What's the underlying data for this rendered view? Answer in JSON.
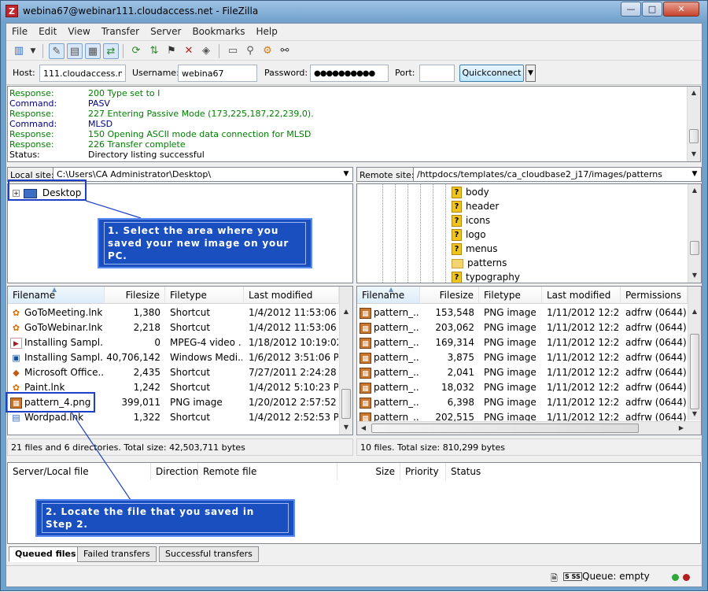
{
  "window": {
    "title": "webina67@webinar111.cloudaccess.net - FileZilla",
    "app_icon": "Z",
    "controls": {
      "minimize": "—",
      "maximize": "□",
      "close": "✕"
    }
  },
  "menu": [
    "File",
    "Edit",
    "View",
    "Transfer",
    "Server",
    "Bookmarks",
    "Help"
  ],
  "toolbar_icons": [
    "site-manager-icon",
    "dropdown-arrow-icon",
    "toggle-log-icon",
    "toggle-local-tree-icon",
    "toggle-remote-tree-icon",
    "toggle-queue-icon",
    "refresh-icon",
    "process-queue-icon",
    "cancel-icon",
    "disconnect-icon",
    "reconnect-icon",
    "directory-listing-icon",
    "filter-icon",
    "compare-icon",
    "search-icon"
  ],
  "quickconnect": {
    "host_label": "Host:",
    "host_value": "111.cloudaccess.net",
    "username_label": "Username:",
    "username_value": "webina67",
    "password_label": "Password:",
    "password_value": "●●●●●●●●●●",
    "port_label": "Port:",
    "port_value": "",
    "button_label": "Quickconnect"
  },
  "log": [
    {
      "type": "Response:",
      "message": "200 Type set to I",
      "color": "#008000"
    },
    {
      "type": "Command:",
      "message": "PASV",
      "color": "#000080"
    },
    {
      "type": "Response:",
      "message": "227 Entering Passive Mode (173,225,187,22,239,0).",
      "color": "#008000"
    },
    {
      "type": "Command:",
      "message": "MLSD",
      "color": "#000080"
    },
    {
      "type": "Response:",
      "message": "150 Opening ASCII mode data connection for MLSD",
      "color": "#008000"
    },
    {
      "type": "Response:",
      "message": "226 Transfer complete",
      "color": "#008000"
    },
    {
      "type": "Status:",
      "message": "Directory listing successful",
      "color": "#000000"
    }
  ],
  "local": {
    "site_label": "Local site:",
    "path": "C:\\Users\\CA Administrator\\Desktop\\",
    "tree": [
      {
        "label": "Desktop"
      }
    ],
    "columns": [
      "Filename",
      "Filesize",
      "Filetype",
      "Last modified"
    ],
    "files": [
      {
        "name": "GoToMeeting.lnk",
        "size": "1,380",
        "type": "Shortcut",
        "modified": "1/4/2012 11:53:06 ...",
        "icon": "shortcut"
      },
      {
        "name": "GoToWebinar.lnk",
        "size": "2,218",
        "type": "Shortcut",
        "modified": "1/4/2012 11:53:06 ...",
        "icon": "shortcut"
      },
      {
        "name": "Installing Sampl...",
        "size": "0",
        "type": "MPEG-4 video ...",
        "modified": "1/18/2012 10:19:02...",
        "icon": "video"
      },
      {
        "name": "Installing Sampl...",
        "size": "40,706,142",
        "type": "Windows Medi...",
        "modified": "1/6/2012 3:51:06 PM",
        "icon": "media"
      },
      {
        "name": "Microsoft Office...",
        "size": "2,435",
        "type": "Shortcut",
        "modified": "7/27/2011 2:24:28 ...",
        "icon": "office"
      },
      {
        "name": "Paint.lnk",
        "size": "1,242",
        "type": "Shortcut",
        "modified": "1/4/2012 5:10:23 PM",
        "icon": "shortcut"
      },
      {
        "name": "pattern_4.png",
        "size": "399,011",
        "type": "PNG image",
        "modified": "1/20/2012 2:57:52 ...",
        "icon": "png"
      },
      {
        "name": "Wordpad.lnk",
        "size": "1,322",
        "type": "Shortcut",
        "modified": "1/4/2012 2:52:53 PM",
        "icon": "doc"
      }
    ],
    "status": "21 files and 6 directories. Total size: 42,503,711 bytes"
  },
  "remote": {
    "site_label": "Remote site:",
    "path": "/httpdocs/templates/ca_cloudbase2_j17/images/patterns",
    "tree": [
      {
        "label": "body",
        "icon": "unknown"
      },
      {
        "label": "header",
        "icon": "unknown"
      },
      {
        "label": "icons",
        "icon": "unknown"
      },
      {
        "label": "logo",
        "icon": "unknown"
      },
      {
        "label": "menus",
        "icon": "unknown"
      },
      {
        "label": "patterns",
        "icon": "folder"
      },
      {
        "label": "typography",
        "icon": "unknown"
      }
    ],
    "columns": [
      "Filename",
      "Filesize",
      "Filetype",
      "Last modified",
      "Permissions"
    ],
    "files": [
      {
        "name": "pattern_...",
        "size": "153,548",
        "type": "PNG image",
        "modified": "1/11/2012 12:2...",
        "perms": "adfrw (0644)"
      },
      {
        "name": "pattern_...",
        "size": "203,062",
        "type": "PNG image",
        "modified": "1/11/2012 12:2...",
        "perms": "adfrw (0644)"
      },
      {
        "name": "pattern_...",
        "size": "169,314",
        "type": "PNG image",
        "modified": "1/11/2012 12:2...",
        "perms": "adfrw (0644)"
      },
      {
        "name": "pattern_...",
        "size": "3,875",
        "type": "PNG image",
        "modified": "1/11/2012 12:2...",
        "perms": "adfrw (0644)"
      },
      {
        "name": "pattern_...",
        "size": "2,041",
        "type": "PNG image",
        "modified": "1/11/2012 12:2...",
        "perms": "adfrw (0644)"
      },
      {
        "name": "pattern_...",
        "size": "18,032",
        "type": "PNG image",
        "modified": "1/11/2012 12:2...",
        "perms": "adfrw (0644)"
      },
      {
        "name": "pattern_...",
        "size": "6,398",
        "type": "PNG image",
        "modified": "1/11/2012 12:2...",
        "perms": "adfrw (0644)"
      },
      {
        "name": "pattern_...",
        "size": "202,515",
        "type": "PNG image",
        "modified": "1/11/2012 12:2...",
        "perms": "adfrw (0644)"
      }
    ],
    "status": "10 files. Total size: 810,299 bytes"
  },
  "queue": {
    "columns": [
      "Server/Local file",
      "Direction",
      "Remote file",
      "Size",
      "Priority",
      "Status"
    ],
    "tabs": [
      "Queued files",
      "Failed transfers",
      "Successful transfers"
    ],
    "status": "Queue: empty"
  },
  "annotations": {
    "step1": "1. Select the area where you saved your new image on your PC.",
    "step1_line1": "1. Select the area where you",
    "step1_line2": "saved your new image on your PC.",
    "step2": "2. Locate the file that you saved in Step 2."
  },
  "colors": {
    "accent": "#1a4fc0",
    "response": "#008000",
    "command": "#000080",
    "led_green": "#2fa83a",
    "led_red": "#b02020"
  }
}
